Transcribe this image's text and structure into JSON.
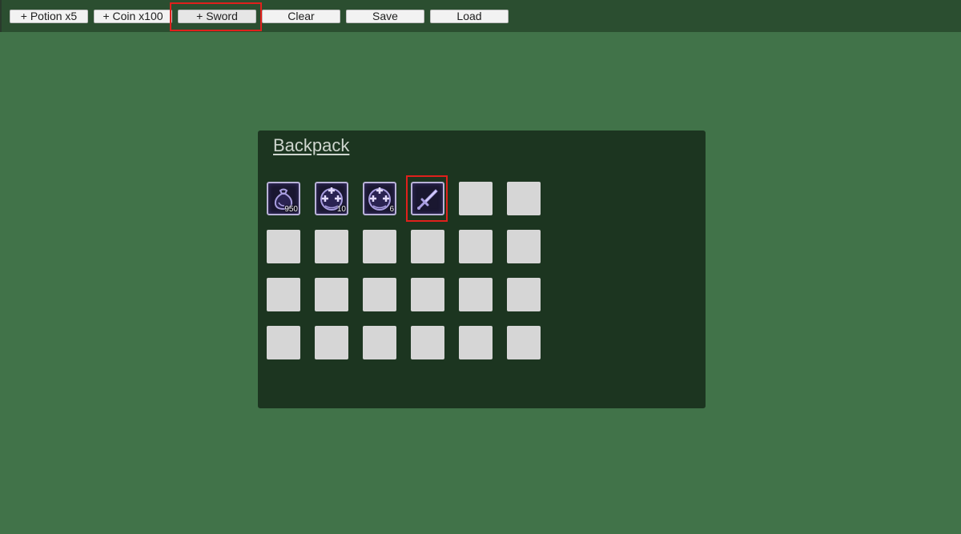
{
  "toolbar": {
    "buttons": [
      {
        "id": "add-potion",
        "label": "+ Potion x5"
      },
      {
        "id": "add-coin",
        "label": "+ Coin x100"
      },
      {
        "id": "add-sword",
        "label": "+ Sword"
      },
      {
        "id": "clear",
        "label": "Clear"
      },
      {
        "id": "save",
        "label": "Save"
      },
      {
        "id": "load",
        "label": "Load"
      }
    ],
    "highlighted_button": "+ Sword"
  },
  "backpack": {
    "title": "Backpack",
    "rows": 4,
    "columns": 6,
    "items": [
      {
        "slot": 0,
        "icon": "coin-bag-icon",
        "quantity": "950"
      },
      {
        "slot": 1,
        "icon": "potion-icon",
        "quantity": "10"
      },
      {
        "slot": 2,
        "icon": "potion-icon",
        "quantity": "6"
      },
      {
        "slot": 3,
        "icon": "sword-icon",
        "quantity": ""
      }
    ],
    "highlighted_slot": 3
  },
  "colors": {
    "background": "#417349",
    "toolbar": "#2b4e30",
    "panel": "#1c3520",
    "empty_slot": "#d6d6d6",
    "highlight": "#e0201c",
    "item_glyph": "#a99ee0"
  }
}
